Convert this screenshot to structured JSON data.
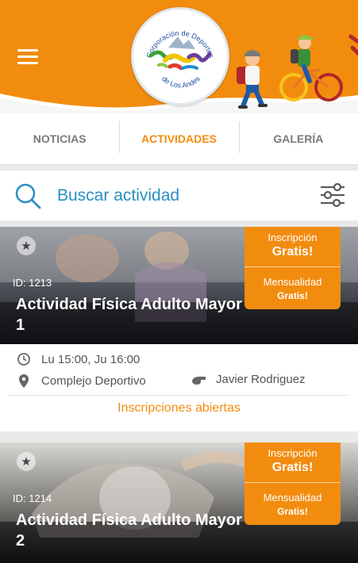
{
  "header": {
    "logo_text_top": "Corporación de Deportes",
    "logo_text_bottom": "de Los Andes"
  },
  "tabs": [
    {
      "label": "NOTICIAS",
      "active": false
    },
    {
      "label": "ACTIVIDADES",
      "active": true
    },
    {
      "label": "GALERÍA",
      "active": false
    }
  ],
  "search": {
    "placeholder": "Buscar actividad"
  },
  "activities": [
    {
      "id_label": "ID: 1213",
      "title": "Actividad Física Adulto Mayor 1",
      "inscription_label": "Inscripción",
      "inscription_value": "Gratis!",
      "monthly_label": "Mensualidad",
      "monthly_value": "Gratis!",
      "schedule": "Lu 15:00, Ju 16:00",
      "location": "Complejo  Deportivo",
      "instructor": "Javier Rodriguez",
      "status": "Inscripciones abiertas"
    },
    {
      "id_label": "ID: 1214",
      "title": "Actividad Física Adulto Mayor 2",
      "inscription_label": "Inscripción",
      "inscription_value": "Gratis!",
      "monthly_label": "Mensualidad",
      "monthly_value": "Gratis!"
    }
  ],
  "colors": {
    "accent": "#f28c0f",
    "link": "#2a8fc2"
  }
}
